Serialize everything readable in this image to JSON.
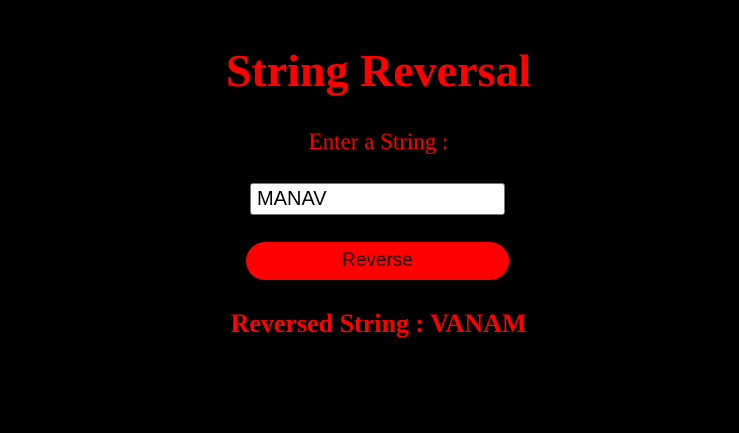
{
  "page": {
    "title": "String Reversal",
    "prompt_label": "Enter a String :",
    "input": {
      "value": "MANAV",
      "placeholder": ""
    },
    "reverse_button_label": "Reverse",
    "result_text": "Reversed String : VANAM"
  },
  "colors": {
    "background": "#000000",
    "accent": "#ff0000",
    "input_background": "#ffffff"
  }
}
